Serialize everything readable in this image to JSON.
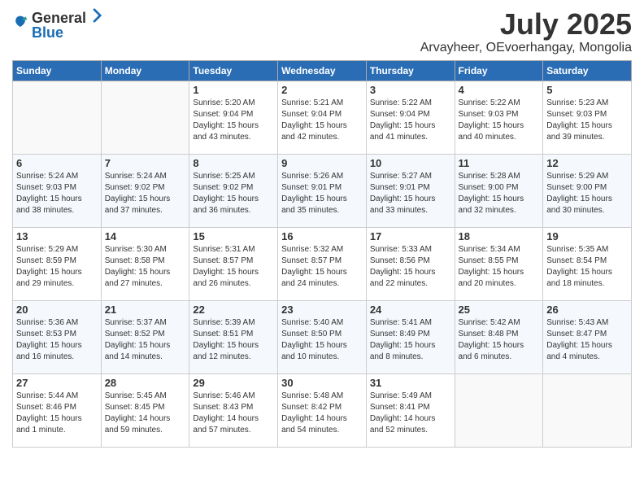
{
  "logo": {
    "general": "General",
    "blue": "Blue"
  },
  "title": "July 2025",
  "location": "Arvayheer, OEvoerhangay, Mongolia",
  "headers": [
    "Sunday",
    "Monday",
    "Tuesday",
    "Wednesday",
    "Thursday",
    "Friday",
    "Saturday"
  ],
  "weeks": [
    [
      {
        "day": "",
        "info": ""
      },
      {
        "day": "",
        "info": ""
      },
      {
        "day": "1",
        "info": "Sunrise: 5:20 AM\nSunset: 9:04 PM\nDaylight: 15 hours and 43 minutes."
      },
      {
        "day": "2",
        "info": "Sunrise: 5:21 AM\nSunset: 9:04 PM\nDaylight: 15 hours and 42 minutes."
      },
      {
        "day": "3",
        "info": "Sunrise: 5:22 AM\nSunset: 9:04 PM\nDaylight: 15 hours and 41 minutes."
      },
      {
        "day": "4",
        "info": "Sunrise: 5:22 AM\nSunset: 9:03 PM\nDaylight: 15 hours and 40 minutes."
      },
      {
        "day": "5",
        "info": "Sunrise: 5:23 AM\nSunset: 9:03 PM\nDaylight: 15 hours and 39 minutes."
      }
    ],
    [
      {
        "day": "6",
        "info": "Sunrise: 5:24 AM\nSunset: 9:03 PM\nDaylight: 15 hours and 38 minutes."
      },
      {
        "day": "7",
        "info": "Sunrise: 5:24 AM\nSunset: 9:02 PM\nDaylight: 15 hours and 37 minutes."
      },
      {
        "day": "8",
        "info": "Sunrise: 5:25 AM\nSunset: 9:02 PM\nDaylight: 15 hours and 36 minutes."
      },
      {
        "day": "9",
        "info": "Sunrise: 5:26 AM\nSunset: 9:01 PM\nDaylight: 15 hours and 35 minutes."
      },
      {
        "day": "10",
        "info": "Sunrise: 5:27 AM\nSunset: 9:01 PM\nDaylight: 15 hours and 33 minutes."
      },
      {
        "day": "11",
        "info": "Sunrise: 5:28 AM\nSunset: 9:00 PM\nDaylight: 15 hours and 32 minutes."
      },
      {
        "day": "12",
        "info": "Sunrise: 5:29 AM\nSunset: 9:00 PM\nDaylight: 15 hours and 30 minutes."
      }
    ],
    [
      {
        "day": "13",
        "info": "Sunrise: 5:29 AM\nSunset: 8:59 PM\nDaylight: 15 hours and 29 minutes."
      },
      {
        "day": "14",
        "info": "Sunrise: 5:30 AM\nSunset: 8:58 PM\nDaylight: 15 hours and 27 minutes."
      },
      {
        "day": "15",
        "info": "Sunrise: 5:31 AM\nSunset: 8:57 PM\nDaylight: 15 hours and 26 minutes."
      },
      {
        "day": "16",
        "info": "Sunrise: 5:32 AM\nSunset: 8:57 PM\nDaylight: 15 hours and 24 minutes."
      },
      {
        "day": "17",
        "info": "Sunrise: 5:33 AM\nSunset: 8:56 PM\nDaylight: 15 hours and 22 minutes."
      },
      {
        "day": "18",
        "info": "Sunrise: 5:34 AM\nSunset: 8:55 PM\nDaylight: 15 hours and 20 minutes."
      },
      {
        "day": "19",
        "info": "Sunrise: 5:35 AM\nSunset: 8:54 PM\nDaylight: 15 hours and 18 minutes."
      }
    ],
    [
      {
        "day": "20",
        "info": "Sunrise: 5:36 AM\nSunset: 8:53 PM\nDaylight: 15 hours and 16 minutes."
      },
      {
        "day": "21",
        "info": "Sunrise: 5:37 AM\nSunset: 8:52 PM\nDaylight: 15 hours and 14 minutes."
      },
      {
        "day": "22",
        "info": "Sunrise: 5:39 AM\nSunset: 8:51 PM\nDaylight: 15 hours and 12 minutes."
      },
      {
        "day": "23",
        "info": "Sunrise: 5:40 AM\nSunset: 8:50 PM\nDaylight: 15 hours and 10 minutes."
      },
      {
        "day": "24",
        "info": "Sunrise: 5:41 AM\nSunset: 8:49 PM\nDaylight: 15 hours and 8 minutes."
      },
      {
        "day": "25",
        "info": "Sunrise: 5:42 AM\nSunset: 8:48 PM\nDaylight: 15 hours and 6 minutes."
      },
      {
        "day": "26",
        "info": "Sunrise: 5:43 AM\nSunset: 8:47 PM\nDaylight: 15 hours and 4 minutes."
      }
    ],
    [
      {
        "day": "27",
        "info": "Sunrise: 5:44 AM\nSunset: 8:46 PM\nDaylight: 15 hours and 1 minute."
      },
      {
        "day": "28",
        "info": "Sunrise: 5:45 AM\nSunset: 8:45 PM\nDaylight: 14 hours and 59 minutes."
      },
      {
        "day": "29",
        "info": "Sunrise: 5:46 AM\nSunset: 8:43 PM\nDaylight: 14 hours and 57 minutes."
      },
      {
        "day": "30",
        "info": "Sunrise: 5:48 AM\nSunset: 8:42 PM\nDaylight: 14 hours and 54 minutes."
      },
      {
        "day": "31",
        "info": "Sunrise: 5:49 AM\nSunset: 8:41 PM\nDaylight: 14 hours and 52 minutes."
      },
      {
        "day": "",
        "info": ""
      },
      {
        "day": "",
        "info": ""
      }
    ]
  ]
}
